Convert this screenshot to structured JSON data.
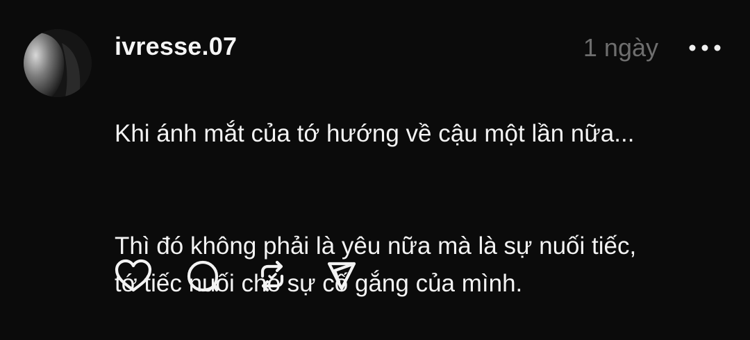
{
  "post": {
    "username": "ivresse.07",
    "timestamp": "1 ngày",
    "paragraphs": [
      "Khi ánh mắt của tớ hướng về cậu một lần nữa...",
      "Thì đó không phải là yêu nữa mà là sự nuối tiếc,\ntớ tiếc nuối cho sự cố gắng của mình."
    ]
  },
  "icons": {
    "avatar": "profile-photo",
    "more": "more-horizontal-icon",
    "like": "heart-icon",
    "comment": "comment-bubble-icon",
    "repost": "repost-icon",
    "share": "send-icon"
  },
  "colors": {
    "background": "#0b0b0b",
    "text": "#f3f3f3",
    "muted": "#6e6e6e"
  }
}
